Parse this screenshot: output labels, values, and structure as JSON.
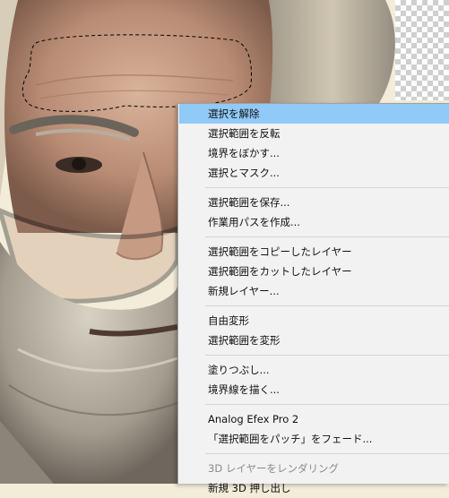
{
  "menu": {
    "groups": [
      [
        {
          "label": "選択を解除",
          "state": "hover"
        },
        {
          "label": "選択範囲を反転"
        },
        {
          "label": "境界をぼかす..."
        },
        {
          "label": "選択とマスク..."
        }
      ],
      [
        {
          "label": "選択範囲を保存..."
        },
        {
          "label": "作業用パスを作成..."
        }
      ],
      [
        {
          "label": "選択範囲をコピーしたレイヤー"
        },
        {
          "label": "選択範囲をカットしたレイヤー"
        },
        {
          "label": "新規レイヤー..."
        }
      ],
      [
        {
          "label": "自由変形"
        },
        {
          "label": "選択範囲を変形"
        }
      ],
      [
        {
          "label": "塗りつぶし..."
        },
        {
          "label": "境界線を描く..."
        }
      ],
      [
        {
          "label": "Analog Efex Pro 2"
        },
        {
          "label": "「選択範囲をパッチ」をフェード..."
        }
      ],
      [
        {
          "label": "3D レイヤーをレンダリング",
          "state": "disabled"
        },
        {
          "label": "新規 3D 押し出し"
        }
      ]
    ]
  },
  "colors": {
    "hover": "#91c9f7",
    "menu_bg": "#f2f2f2",
    "disabled_text": "#8a8a8a"
  }
}
